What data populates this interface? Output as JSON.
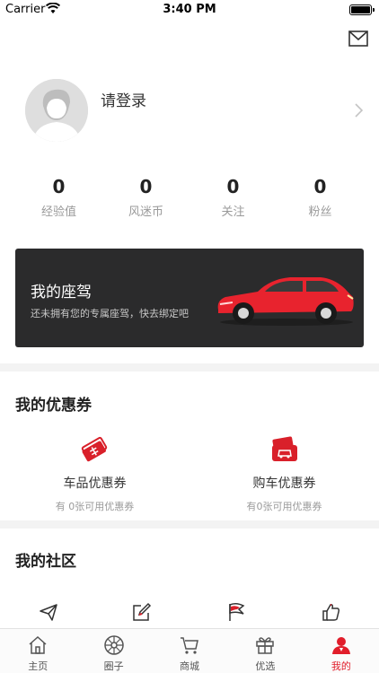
{
  "status_bar": {
    "carrier": "Carrier",
    "time": "3:40 PM"
  },
  "profile": {
    "login_prompt": "请登录"
  },
  "stats": [
    {
      "value": "0",
      "label": "经验值"
    },
    {
      "value": "0",
      "label": "风迷币"
    },
    {
      "value": "0",
      "label": "关注"
    },
    {
      "value": "0",
      "label": "粉丝"
    }
  ],
  "my_car": {
    "title": "我的座驾",
    "subtitle": "还未拥有您的专属座驾，快去绑定吧",
    "car_color": "#e8232e"
  },
  "coupons": {
    "section_title": "我的优惠券",
    "items": [
      {
        "name": "车品优惠券",
        "count": "有 0张可用优惠券"
      },
      {
        "name": "购车优惠券",
        "count": "有0张可用优惠券"
      }
    ]
  },
  "community": {
    "section_title": "我的社区",
    "icons": [
      "send-icon",
      "edit-icon",
      "flag-icon",
      "thumbs-up-icon"
    ]
  },
  "tabbar": {
    "active_color": "#e11e2b",
    "items": [
      {
        "label": "主页",
        "icon": "home-icon"
      },
      {
        "label": "圈子",
        "icon": "wheel-icon"
      },
      {
        "label": "商城",
        "icon": "cart-icon"
      },
      {
        "label": "优选",
        "icon": "gift-icon"
      },
      {
        "label": "我的",
        "icon": "user-icon"
      }
    ],
    "active_index": 4
  }
}
